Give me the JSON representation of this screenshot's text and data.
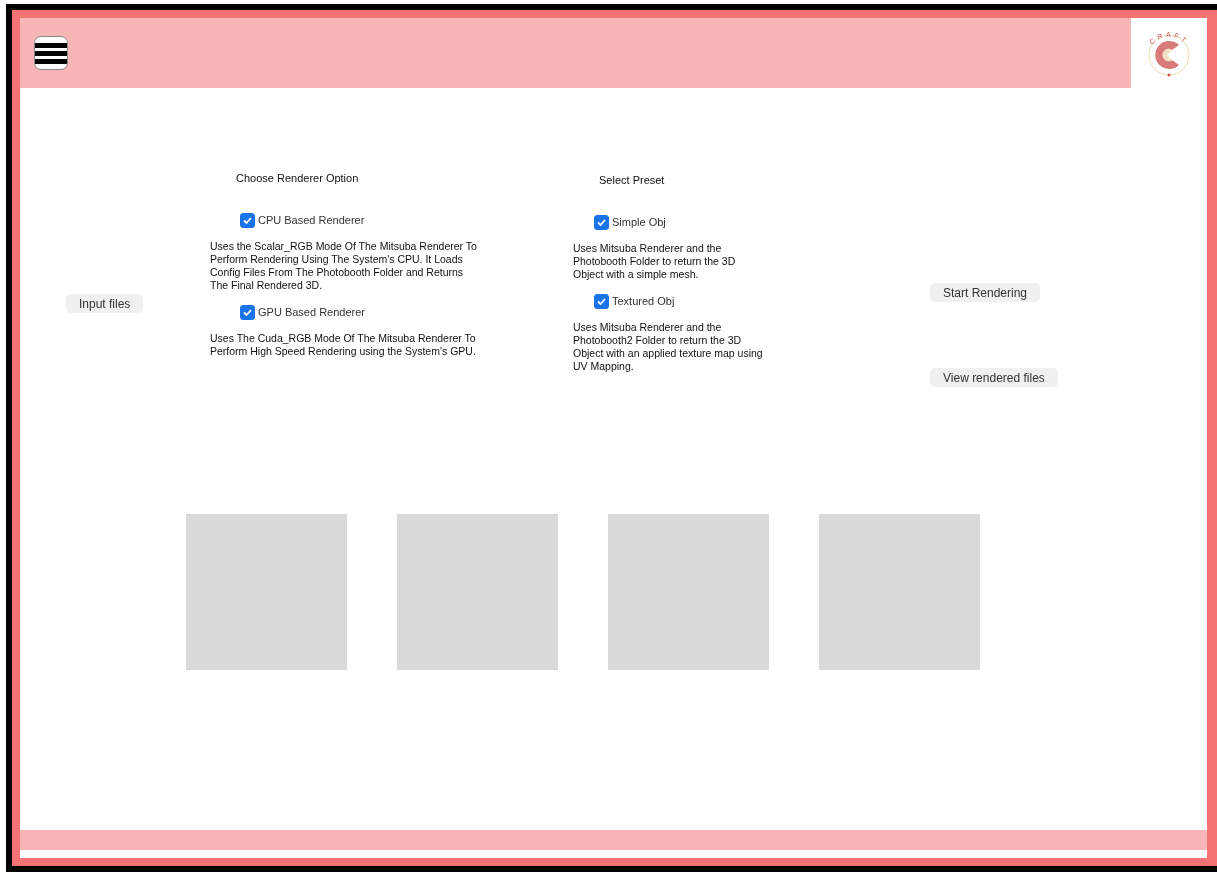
{
  "header": {
    "logo_text": "CRAFT"
  },
  "input_button": "Input files",
  "renderer": {
    "title": "Choose Renderer Option",
    "options": [
      {
        "label": "CPU Based Renderer",
        "checked": true,
        "description": "Uses the Scalar_RGB Mode Of The Mitsuba Renderer To Perform Rendering Using The System's CPU. It Loads Config Files From The Photobooth Folder and Returns The Final Rendered 3D."
      },
      {
        "label": "GPU Based Renderer",
        "checked": true,
        "description": "Uses The Cuda_RGB Mode Of The Mitsuba Renderer To Perform High Speed Rendering using the System's GPU."
      }
    ]
  },
  "preset": {
    "title": "Select Preset",
    "options": [
      {
        "label": "Simple Obj",
        "checked": true,
        "description": "Uses Mitsuba Renderer and the Photobooth Folder to return the 3D Object with a simple mesh."
      },
      {
        "label": "Textured Obj",
        "checked": true,
        "description": "Uses Mitsuba Renderer and the Photobooth2 Folder to return the 3D Object with an applied texture map using UV Mapping."
      }
    ]
  },
  "actions": [
    "Start Rendering",
    "View rendered files"
  ],
  "previews": [
    {
      "kind": "placeholder"
    },
    {
      "kind": "placeholder"
    },
    {
      "kind": "placeholder"
    },
    {
      "kind": "placeholder"
    }
  ]
}
